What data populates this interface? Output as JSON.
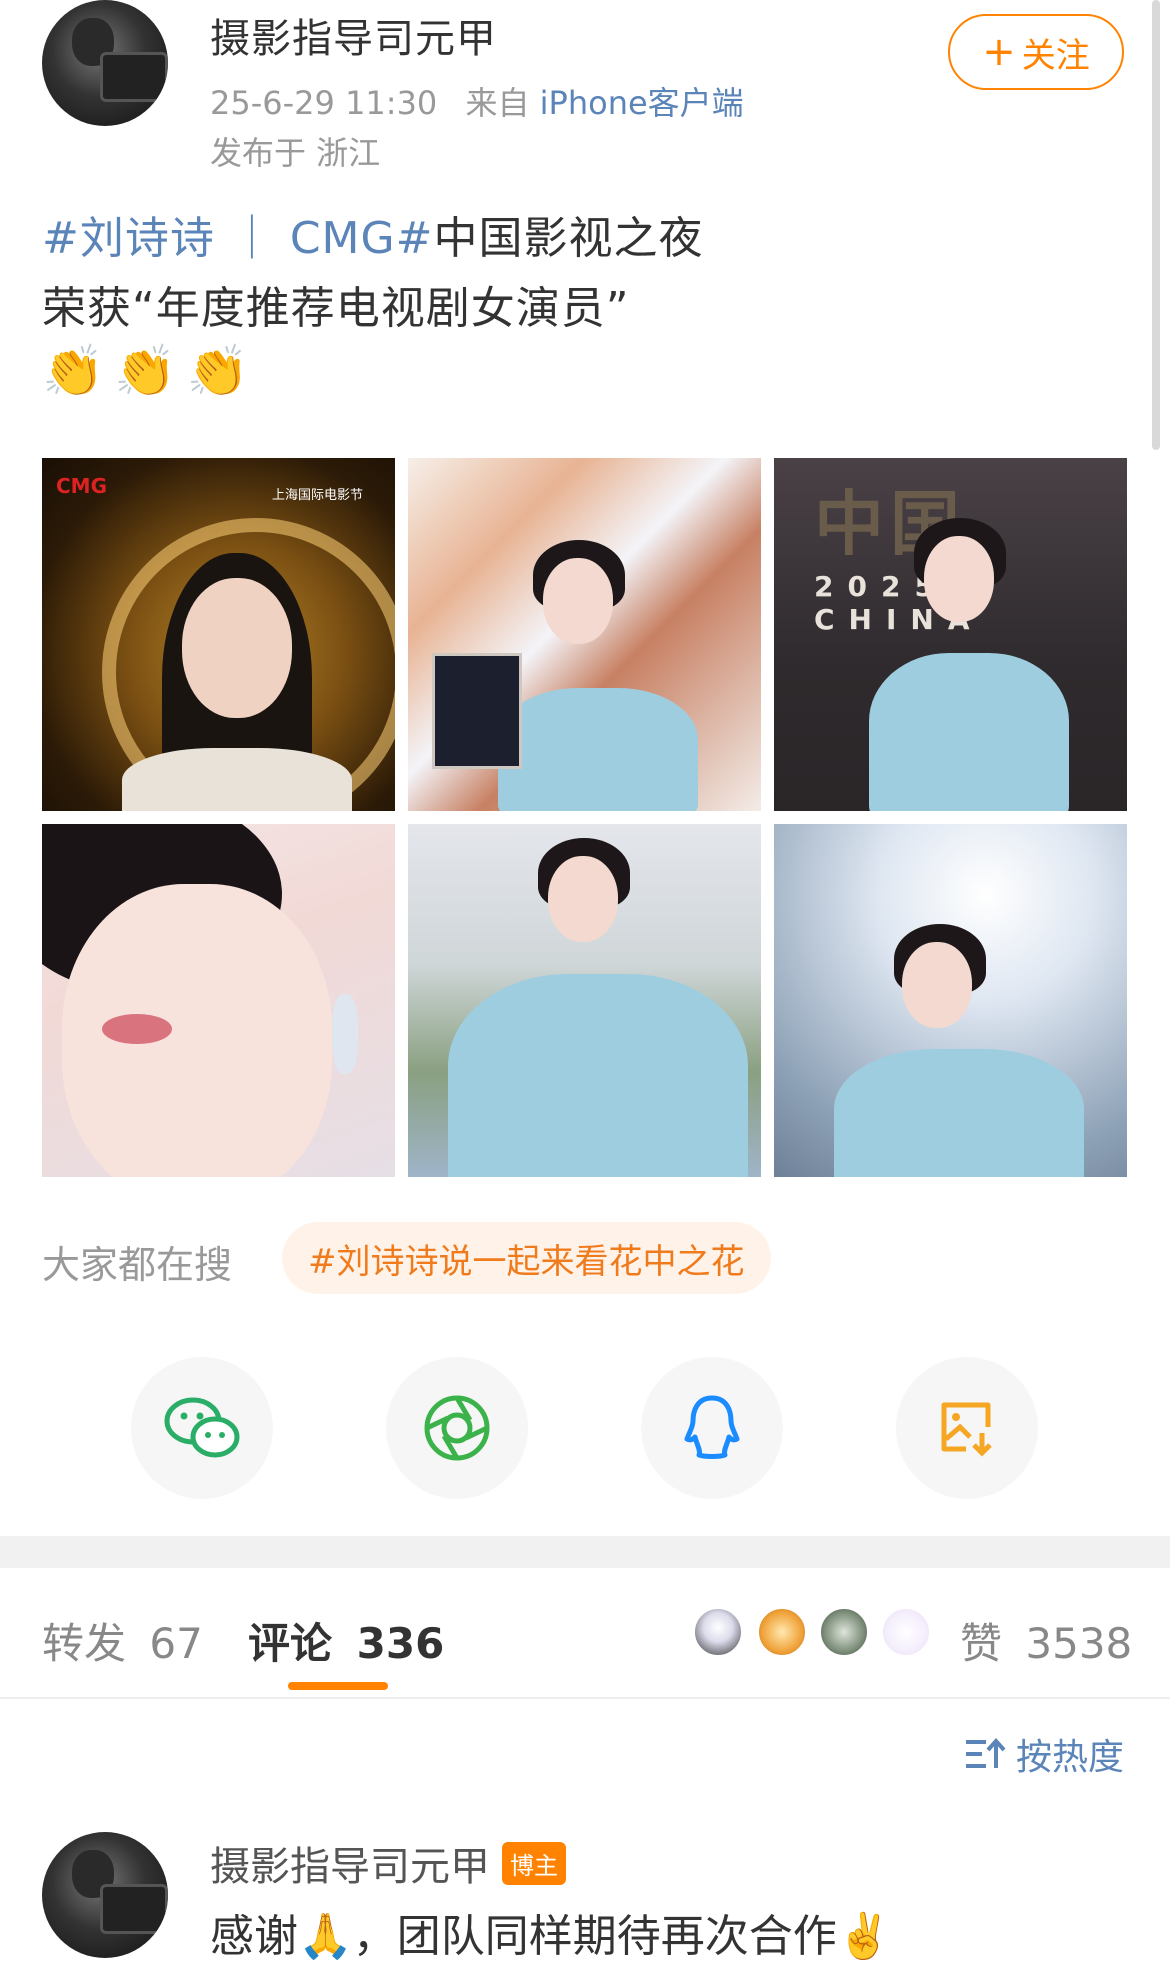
{
  "post": {
    "author": "摄影指导司元甲",
    "date": "25-6-29 11:30",
    "from_label": "来自",
    "client": "iPhone客户端",
    "location": "发布于 浙江",
    "follow_plus": "+",
    "follow_label": "关注",
    "hashtag": "#刘诗诗 ｜ CMG#",
    "text_line1_rest": "中国影视之夜",
    "text_line2": "荣获“年度推荐电视剧女演员”",
    "emojis": "👏👏👏"
  },
  "images": {
    "img1_logo": "CMG",
    "img1_sublogo": "上海国际电影节",
    "img3_big": "中国",
    "img3_year": "2025 CHINA"
  },
  "trending": {
    "label": "大家都在搜",
    "topic": "#刘诗诗说一起来看花中之花"
  },
  "share": {
    "items": [
      "wechat-icon",
      "moments-icon",
      "qq-icon",
      "save-image-icon"
    ]
  },
  "tabs": {
    "repost_label": "转发",
    "repost_count": "67",
    "comment_label": "评论",
    "comment_count": "336",
    "like_label": "赞",
    "like_count": "3538"
  },
  "sort": {
    "label": "按热度"
  },
  "comment": {
    "author": "摄影指导司元甲",
    "badge": "博主",
    "text": "感谢🙏，团队同样期待再次合作✌️"
  },
  "colors": {
    "accent": "#ff8200",
    "link": "#5b84b8",
    "wechat": "#2aae67",
    "moments": "#3cb34a",
    "qq": "#1a8cff",
    "save": "#f5a623"
  }
}
